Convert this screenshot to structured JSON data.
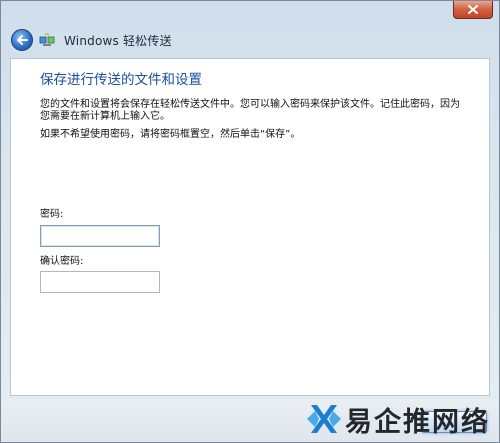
{
  "window": {
    "app_title": "Windows 轻松传送",
    "close_icon": "close-icon",
    "back_icon": "back-arrow-icon"
  },
  "page": {
    "heading": "保存进行传送的文件和设置",
    "description": "您的文件和设置将会保存在轻松传送文件中。您可以输入密码来保护该文件。记住此密码，因为您需要在新计算机上输入它。",
    "instruction": "如果不希望使用密码，请将密码框置空，然后单击“保存”。",
    "password_label": "密码:",
    "password_value": "",
    "confirm_label": "确认密码:",
    "confirm_value": ""
  },
  "watermark": {
    "text": "易企推网络"
  },
  "colors": {
    "heading": "#1a50a0",
    "close_button": "#c2452a",
    "back_button": "#2a6bc2"
  }
}
